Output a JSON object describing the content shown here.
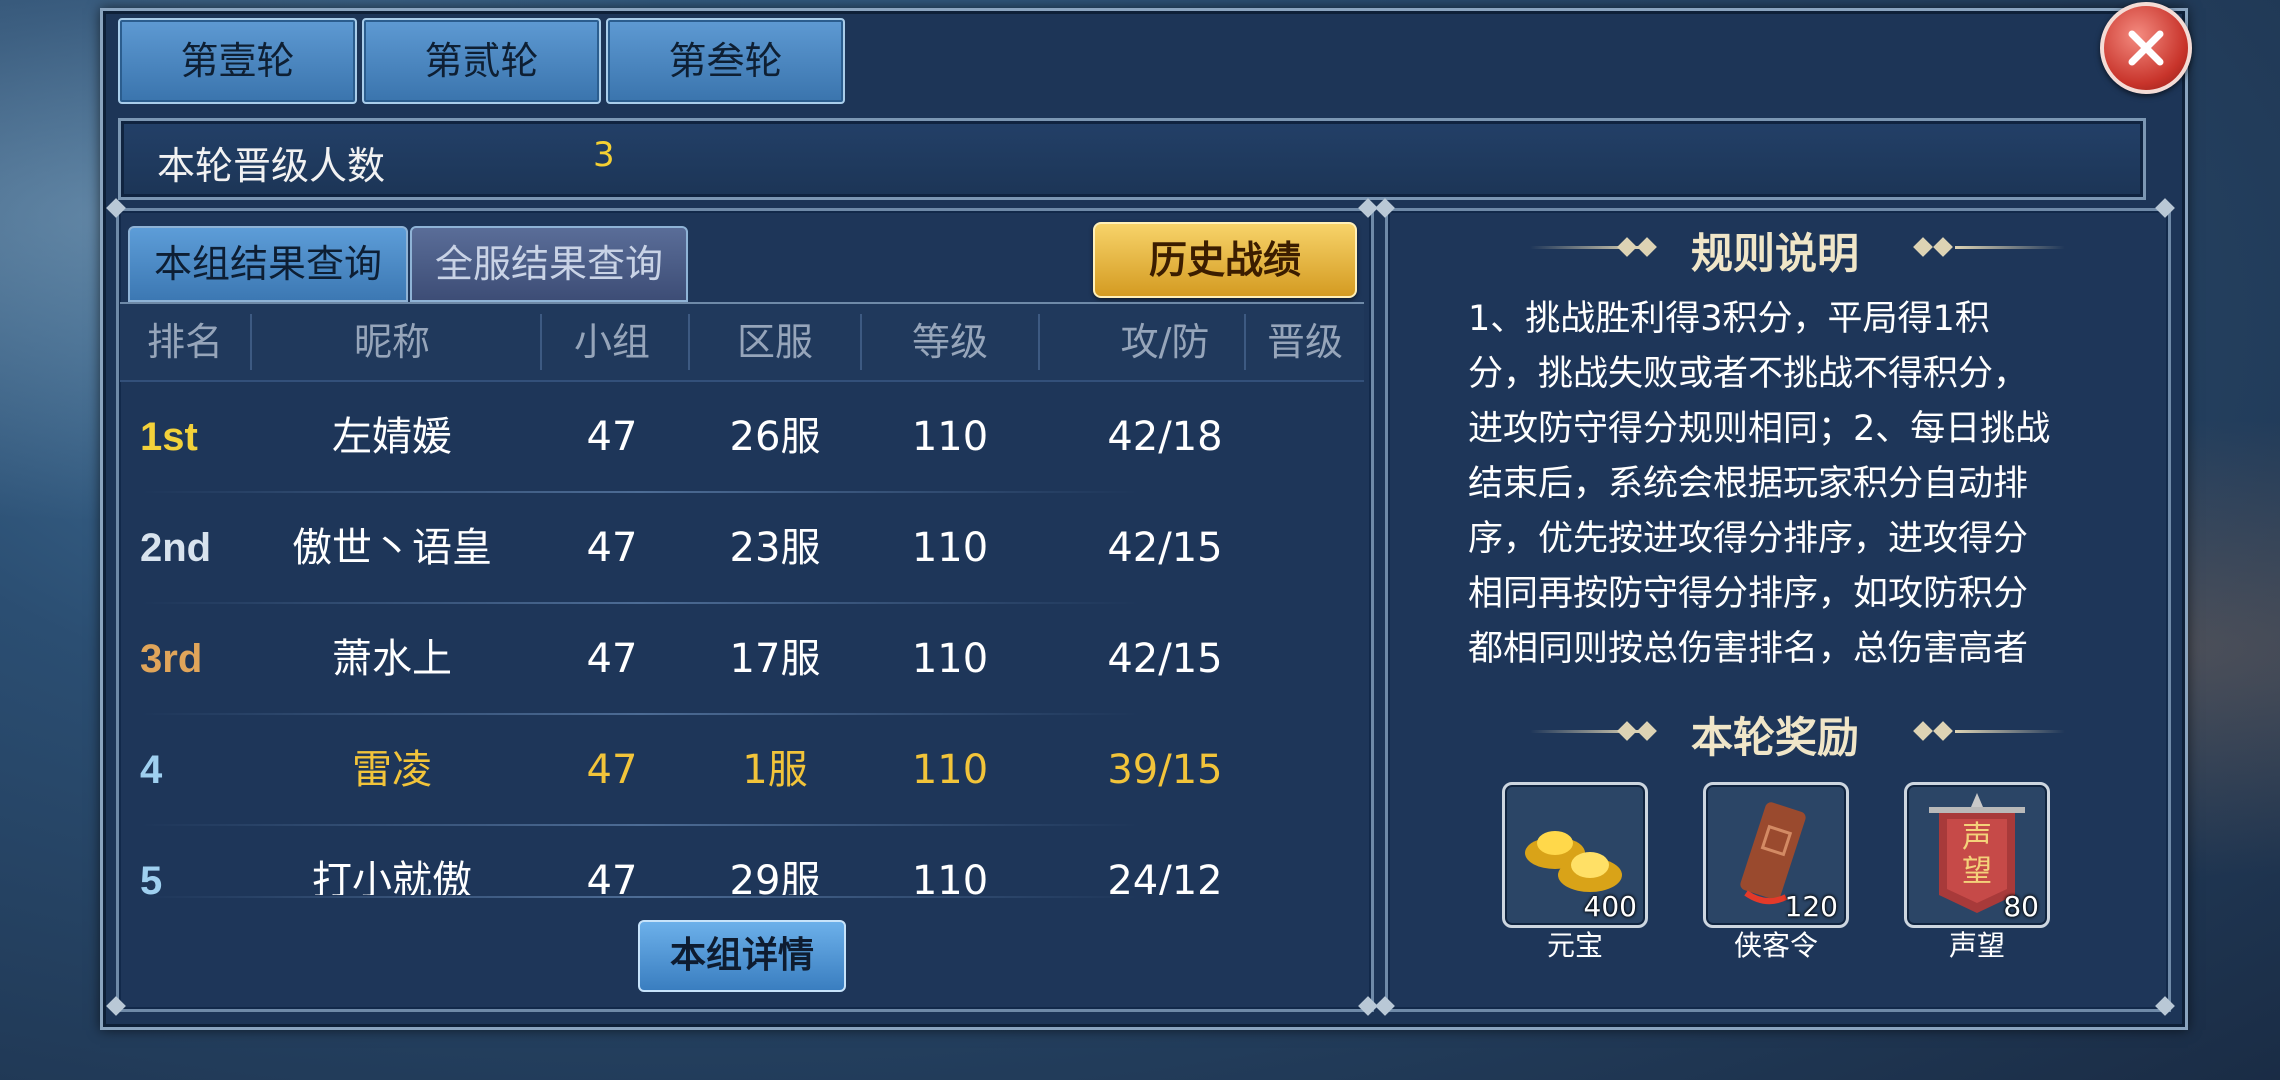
{
  "rounds": [
    "第壹轮",
    "第贰轮",
    "第叁轮"
  ],
  "promotion": {
    "label": "本轮晋级人数",
    "value": "3"
  },
  "tabs": {
    "group": "本组结果查询",
    "server": "全服结果查询"
  },
  "history_button": "历史战绩",
  "table": {
    "headers": [
      "排名",
      "昵称",
      "小组",
      "区服",
      "等级",
      "攻/防",
      "晋级"
    ],
    "rows": [
      {
        "rank": "1st",
        "name": "左婧媛",
        "group": "47",
        "server": "26服",
        "level": "110",
        "score": "42/18",
        "color": "#ffffff",
        "rank_color": "#f3d13a"
      },
      {
        "rank": "2nd",
        "name": "傲世丶语皇",
        "group": "47",
        "server": "23服",
        "level": "110",
        "score": "42/15",
        "color": "#ffffff",
        "rank_color": "#d8e3ee"
      },
      {
        "rank": "3rd",
        "name": "萧水上",
        "group": "47",
        "server": "17服",
        "level": "110",
        "score": "42/15",
        "color": "#ffffff",
        "rank_color": "#e0a55a"
      },
      {
        "rank": "4",
        "name": "雷凌",
        "group": "47",
        "server": "1服",
        "level": "110",
        "score": "39/15",
        "color": "#f2c43a",
        "rank_color": "#9fd0f0"
      },
      {
        "rank": "5",
        "name": "打小就傲",
        "group": "47",
        "server": "29服",
        "level": "110",
        "score": "24/12",
        "color": "#ffffff",
        "rank_color": "#9fd0f0"
      }
    ]
  },
  "detail_button": "本组详情",
  "rules": {
    "title": "规则说明",
    "text": "1、挑战胜利得3积分，平局得1积分，挑战失败或者不挑战不得积分，进攻防守得分规则相同；2、每日挑战结束后，系统会根据玩家积分自动排序，优先按进攻得分排序，进攻得分相同再按防守得分排序，如攻防积分都相同则按总伤害排名，总伤害高者"
  },
  "rewards": {
    "title": "本轮奖励",
    "items": [
      {
        "name": "元宝",
        "count": "400",
        "icon": "gold-ingot-icon"
      },
      {
        "name": "侠客令",
        "count": "120",
        "icon": "token-icon"
      },
      {
        "name": "声望",
        "count": "80",
        "icon": "banner-icon",
        "banner_text": "声望"
      }
    ]
  },
  "colors": {
    "gold": "#f5d032",
    "panel": "#1d3557"
  }
}
